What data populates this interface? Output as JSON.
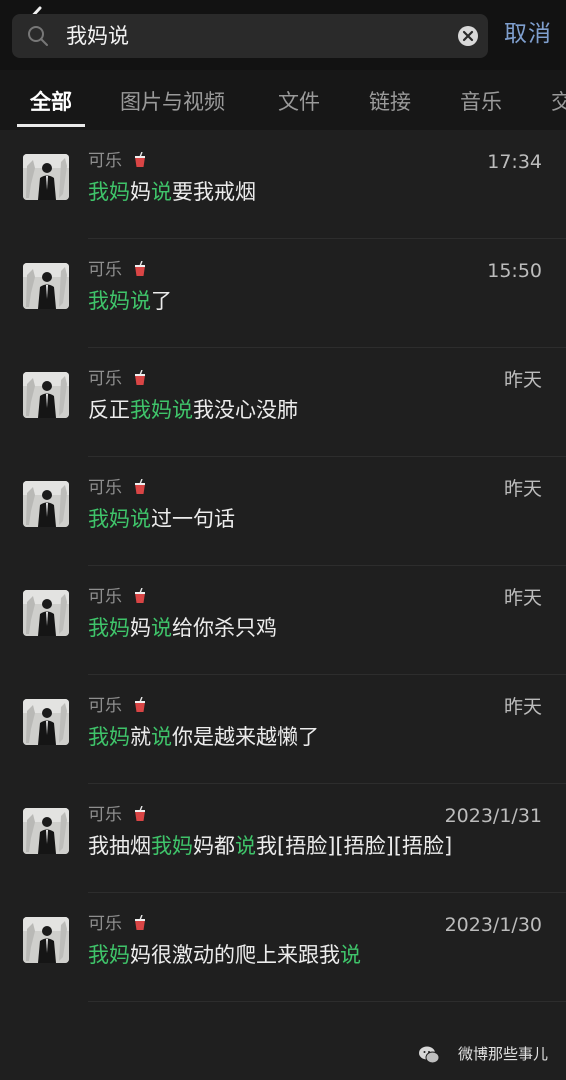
{
  "search": {
    "query": "我妈说",
    "cancel_label": "取消"
  },
  "tabs": [
    "全部",
    "图片与视频",
    "文件",
    "链接",
    "音乐",
    "交"
  ],
  "results": [
    {
      "name": "可乐",
      "time": "17:34",
      "parts": [
        [
          "我妈",
          true
        ],
        [
          "妈",
          false
        ],
        [
          "说",
          true
        ],
        [
          "要我戒烟",
          false
        ]
      ]
    },
    {
      "name": "可乐",
      "time": "15:50",
      "parts": [
        [
          "我妈说",
          true
        ],
        [
          "了",
          false
        ]
      ]
    },
    {
      "name": "可乐",
      "time": "昨天",
      "parts": [
        [
          "反正",
          false
        ],
        [
          "我妈说",
          true
        ],
        [
          "我没心没肺",
          false
        ]
      ]
    },
    {
      "name": "可乐",
      "time": "昨天",
      "parts": [
        [
          "我妈说",
          true
        ],
        [
          "过一句话",
          false
        ]
      ]
    },
    {
      "name": "可乐",
      "time": "昨天",
      "parts": [
        [
          "我妈",
          true
        ],
        [
          "妈",
          false
        ],
        [
          "说",
          true
        ],
        [
          "给你杀只鸡",
          false
        ]
      ]
    },
    {
      "name": "可乐",
      "time": "昨天",
      "parts": [
        [
          "我妈",
          true
        ],
        [
          "就",
          false
        ],
        [
          "说",
          true
        ],
        [
          "你是越来越懒了",
          false
        ]
      ]
    },
    {
      "name": "可乐",
      "time": "2023/1/31",
      "parts": [
        [
          "我抽烟",
          false
        ],
        [
          "我妈",
          true
        ],
        [
          "妈都",
          false
        ],
        [
          "说",
          true
        ],
        [
          "我[捂脸][捂脸][捂脸]",
          false
        ]
      ]
    },
    {
      "name": "可乐",
      "time": "2023/1/30",
      "parts": [
        [
          "我妈",
          true
        ],
        [
          "妈很激动的爬上来跟我",
          false
        ],
        [
          "说",
          true
        ]
      ]
    }
  ],
  "watermark": "微博那些事儿",
  "colors": {
    "highlight": "#3fc46a",
    "accent": "#7f9fce",
    "background": "#1f1f1f"
  }
}
